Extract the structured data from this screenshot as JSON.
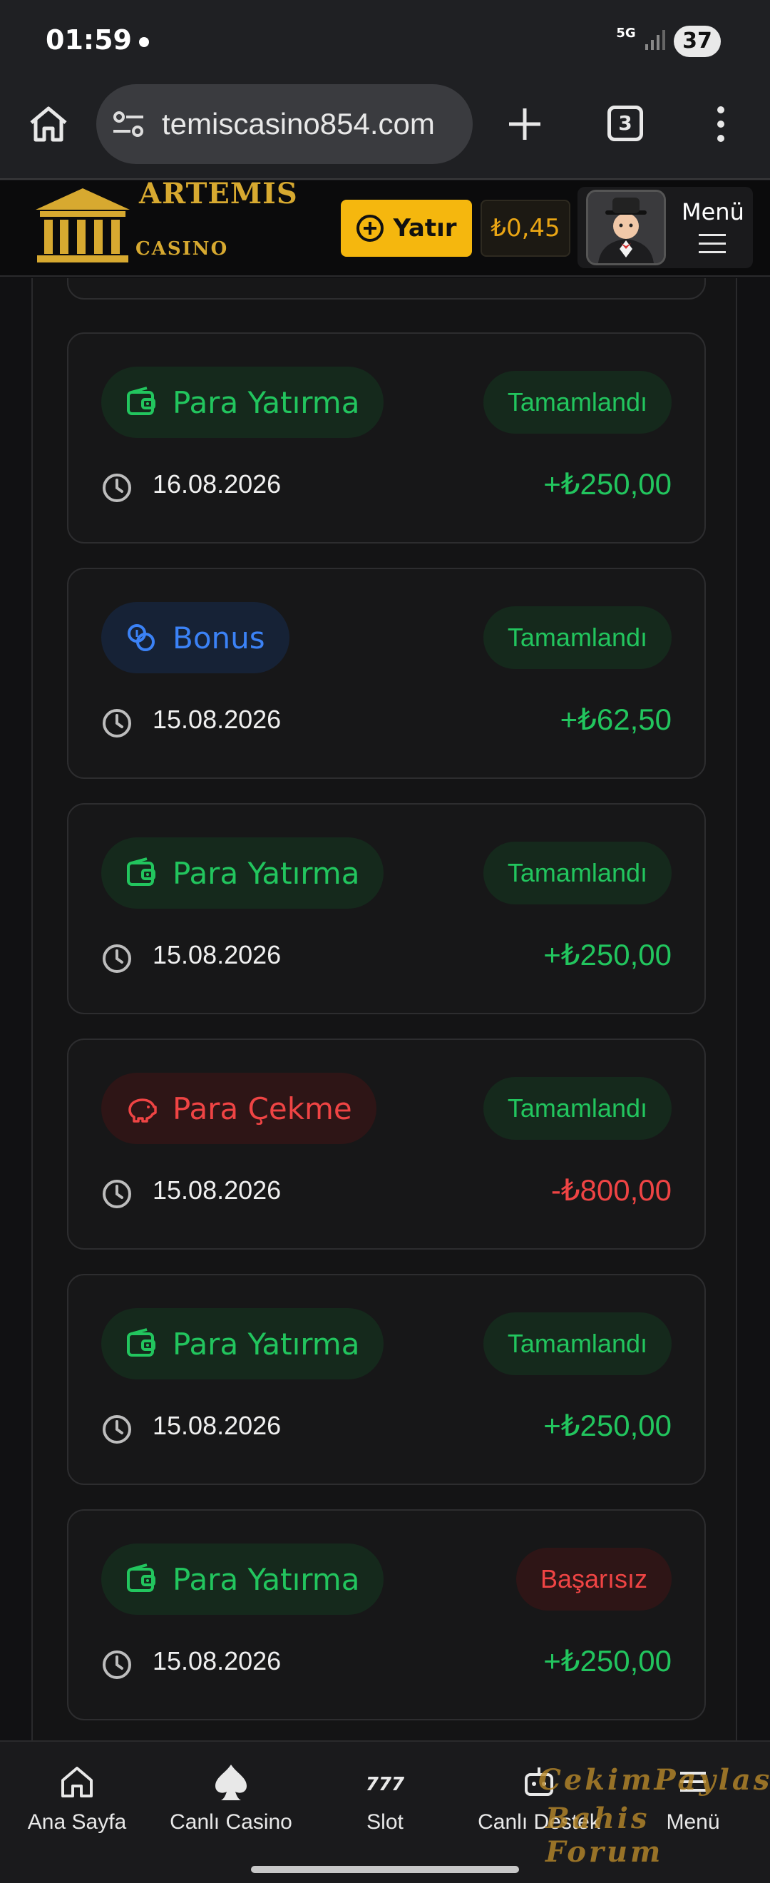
{
  "status_bar": {
    "time": "01:59",
    "network": "5G",
    "battery": "37"
  },
  "browser": {
    "url": "temiscasino854.com",
    "tab_count": "3"
  },
  "header": {
    "logo_title": "ARTEMIS",
    "logo_subtitle": "CASINO",
    "deposit_label": "Yatır",
    "balance": "₺0,45",
    "menu_label": "Menü"
  },
  "transactions": [
    {
      "type": "Para Yatırma",
      "kind": "deposit",
      "status": "Tamamlandı",
      "status_kind": "ok",
      "date": "16.08.2026",
      "amount": "+₺250,00",
      "sign": "pos"
    },
    {
      "type": "Bonus",
      "kind": "bonus",
      "status": "Tamamlandı",
      "status_kind": "ok",
      "date": "15.08.2026",
      "amount": "+₺62,50",
      "sign": "pos"
    },
    {
      "type": "Para Yatırma",
      "kind": "deposit",
      "status": "Tamamlandı",
      "status_kind": "ok",
      "date": "15.08.2026",
      "amount": "+₺250,00",
      "sign": "pos"
    },
    {
      "type": "Para Çekme",
      "kind": "withdraw",
      "status": "Tamamlandı",
      "status_kind": "ok",
      "date": "15.08.2026",
      "amount": "-₺800,00",
      "sign": "neg"
    },
    {
      "type": "Para Yatırma",
      "kind": "deposit",
      "status": "Tamamlandı",
      "status_kind": "ok",
      "date": "15.08.2026",
      "amount": "+₺250,00",
      "sign": "pos"
    },
    {
      "type": "Para Yatırma",
      "kind": "deposit",
      "status": "Başarısız",
      "status_kind": "fail",
      "date": "15.08.2026",
      "amount": "+₺250,00",
      "sign": "pos"
    }
  ],
  "bottom_nav": [
    {
      "label": "Ana Sayfa",
      "icon": "home-icon"
    },
    {
      "label": "Canlı Casino",
      "icon": "spade-icon"
    },
    {
      "label": "Slot",
      "icon": "slot-777-icon"
    },
    {
      "label": "Canlı Destek",
      "icon": "robot-icon"
    },
    {
      "label": "Menü",
      "icon": "menu-icon"
    }
  ],
  "watermark": {
    "line1": "CekimPaylas",
    "line2": "Bahis Forum"
  },
  "colors": {
    "green": "#22c55e",
    "red": "#ef4444",
    "blue": "#3b82f6",
    "gold": "#f5b70e"
  }
}
